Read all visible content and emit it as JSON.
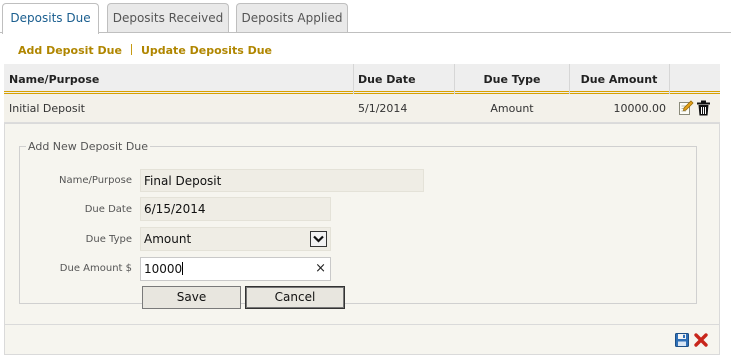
{
  "tabs": [
    {
      "label": "Deposits Due",
      "active": true
    },
    {
      "label": "Deposits Received",
      "active": false
    },
    {
      "label": "Deposits Applied",
      "active": false
    }
  ],
  "actions": {
    "add_deposit_due": "Add Deposit Due",
    "update_deposits_due": "Update Deposits Due"
  },
  "table": {
    "columns": [
      "Name/Purpose",
      "Due Date",
      "Due Type",
      "Due Amount"
    ],
    "rows": [
      {
        "name": "Initial Deposit",
        "due_date": "5/1/2014",
        "due_type": "Amount",
        "due_amount": "10000.00"
      }
    ]
  },
  "form": {
    "legend": "Add New Deposit Due",
    "name_label": "Name/Purpose",
    "name_value": "Final Deposit",
    "date_label": "Due Date",
    "date_value": "6/15/2014",
    "type_label": "Due Type",
    "type_value": "Amount",
    "amount_label": "Due Amount  $",
    "amount_value": "10000",
    "clear_glyph": "×",
    "save_label": "Save",
    "cancel_label": "Cancel"
  },
  "icons": {
    "edit": "edit-icon",
    "delete": "trash-icon",
    "save": "floppy-disk-icon",
    "cancel": "red-x-icon",
    "dropdown": "chevron-down-icon"
  },
  "colors": {
    "accent_gold": "#b08600",
    "active_tab_text": "#1a5e8f",
    "header_underline": "#d8a100"
  }
}
